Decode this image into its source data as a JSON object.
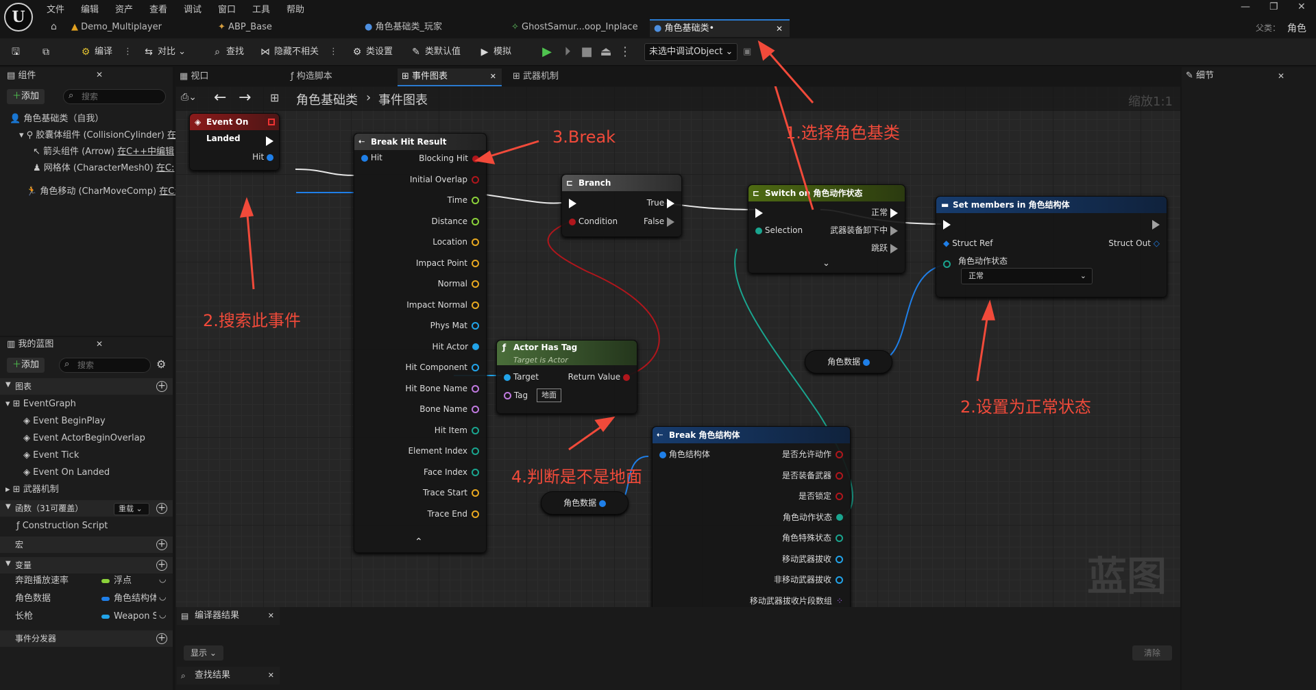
{
  "menu": [
    "文件",
    "编辑",
    "资产",
    "查看",
    "调试",
    "窗口",
    "工具",
    "帮助"
  ],
  "doc_tabs": [
    "Demo_Multiplayer",
    "ABP_Base",
    "角色基础类_玩家",
    "GhostSamur...oop_Inplace",
    "角色基础类•"
  ],
  "parent": {
    "label": "父类：",
    "value": "角色"
  },
  "toolbar": {
    "compile": "编译",
    "diff": "对比",
    "find": "查找",
    "hide_unrelated": "隐藏不相关",
    "class_settings": "类设置",
    "class_defaults": "类默认值",
    "simulate": "模拟",
    "debug_object": "未选中调试Object"
  },
  "components_panel": {
    "title": "组件",
    "add": "添加",
    "search_placeholder": "搜索",
    "items": [
      {
        "label": "角色基础类（自我）"
      },
      {
        "label": "胶囊体组件 (CollisionCylinder)",
        "note": "在"
      },
      {
        "label": "箭头组件 (Arrow)",
        "note": "在C++中编辑"
      },
      {
        "label": "网格体 (CharacterMesh0)",
        "note": "在C:"
      },
      {
        "label": "角色移动 (CharMoveComp)",
        "note": "在C:"
      }
    ]
  },
  "my_blueprint": {
    "title": "我的蓝图",
    "add": "添加",
    "search_placeholder": "搜索",
    "graphs_label": "图表",
    "event_graph": "EventGraph",
    "events": [
      "Event BeginPlay",
      "Event ActorBeginOverlap",
      "Event Tick",
      "Event On Landed"
    ],
    "weapon_graph": "武器机制",
    "functions_label": "函数（31可覆盖）",
    "override": "重载",
    "construction": "Construction Script",
    "macros_label": "宏",
    "variables_label": "变量",
    "variables": [
      {
        "name": "奔跑播放速率",
        "type": "浮点",
        "color": "#8bd13a"
      },
      {
        "name": "角色数据",
        "type": "角色结构体",
        "color": "#1f7fe8"
      },
      {
        "name": "长枪",
        "type": "Weapon S",
        "color": "#22a3e8"
      }
    ],
    "dispatchers_label": "事件分发器"
  },
  "graph_tabs": [
    "视口",
    "构造脚本",
    "事件图表",
    "武器机制"
  ],
  "breadcrumb": {
    "root": "角色基础类",
    "current": "事件图表"
  },
  "zoom": "缩放1:1",
  "watermark": "蓝图",
  "details": {
    "title": "细节"
  },
  "nodes": {
    "event_on_landed": {
      "title": "Event On Landed",
      "hit": "Hit"
    },
    "break_hit": {
      "title": "Break Hit Result",
      "in": "Hit",
      "outs": [
        "Blocking Hit",
        "Initial Overlap",
        "Time",
        "Distance",
        "Location",
        "Impact Point",
        "Normal",
        "Impact Normal",
        "Phys Mat",
        "Hit Actor",
        "Hit Component",
        "Hit Bone Name",
        "Bone Name",
        "Hit Item",
        "Element Index",
        "Face Index",
        "Trace Start",
        "Trace End"
      ]
    },
    "branch": {
      "title": "Branch",
      "condition": "Condition",
      "true": "True",
      "false": "False"
    },
    "switch": {
      "title": "Switch on 角色动作状态",
      "selection": "Selection",
      "outs": [
        "正常",
        "武器装备卸下中",
        "跳跃"
      ]
    },
    "set_members": {
      "title": "Set members in 角色结构体",
      "struct_ref": "Struct Ref",
      "struct_out": "Struct Out",
      "field": "角色动作状态",
      "field_value": "正常"
    },
    "actor_has_tag": {
      "title": "Actor Has Tag",
      "subtitle": "Target is Actor",
      "target": "Target",
      "return": "Return Value",
      "tag": "Tag",
      "tag_value": "地面"
    },
    "break_struct": {
      "title": "Break 角色结构体",
      "in": "角色结构体",
      "outs": [
        "是否允许动作",
        "是否装备武器",
        "是否锁定",
        "角色动作状态",
        "角色特殊状态",
        "移动武器拔收",
        "非移动武器拔收",
        "移动武器拔收片段数组"
      ]
    },
    "var_a": "角色数据",
    "var_b": "角色数据"
  },
  "annotations": [
    "1.选择角色基类",
    "2.搜索此事件",
    "3.Break",
    "2.设置为正常状态",
    "4.判断是不是地面"
  ],
  "bottom": {
    "compiler_results": "编译器结果",
    "show": "显示",
    "clear": "清除",
    "find_results": "查找结果"
  }
}
